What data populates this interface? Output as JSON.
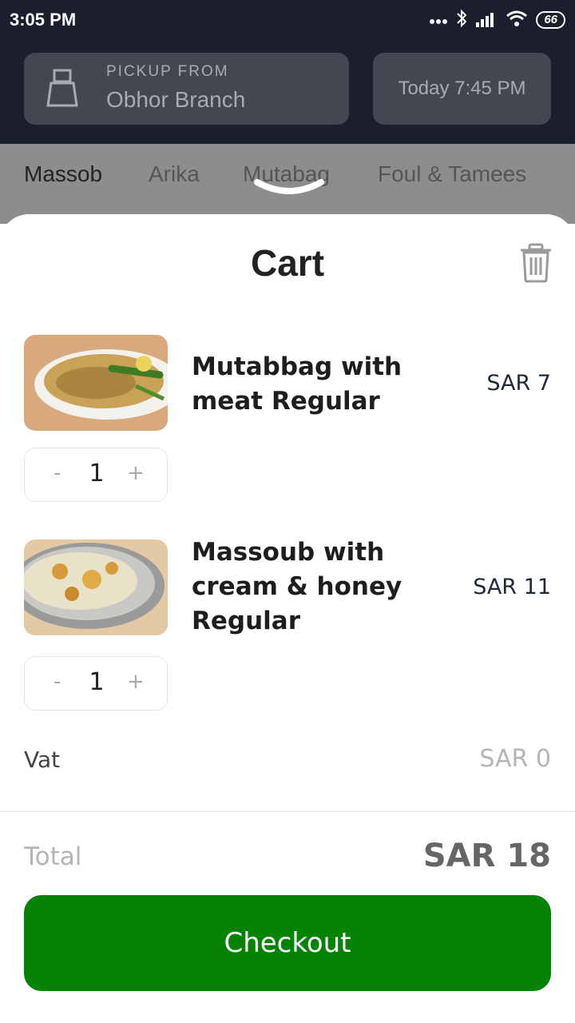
{
  "status_bar": {
    "time": "3:05 PM",
    "battery": "66"
  },
  "header": {
    "pickup_label": "PICKUP FROM",
    "pickup_branch": "Obhor Branch",
    "pickup_time": "Today 7:45 PM"
  },
  "categories": [
    {
      "label": "Massob",
      "active": true
    },
    {
      "label": "Arika",
      "active": false
    },
    {
      "label": "Mutabag",
      "active": false
    },
    {
      "label": "Foul & Tamees",
      "active": false
    }
  ],
  "cart": {
    "title": "Cart",
    "items": [
      {
        "name": "Mutabbag with meat Regular",
        "price": "SAR 7",
        "quantity": "1",
        "minus": "-",
        "plus": "+"
      },
      {
        "name": "Massoub with cream & honey Regular",
        "price": "SAR 11",
        "quantity": "1",
        "minus": "-",
        "plus": "+"
      }
    ],
    "vat_label": "Vat",
    "vat_value": "SAR 0",
    "total_label": "Total",
    "total_value": "SAR 18",
    "checkout_label": "Checkout"
  },
  "colors": {
    "header_bg": "#1b1e2c",
    "checkout_green": "#058304",
    "tab_bg": "#8d8d8d"
  },
  "icons": [
    "bluetooth-icon",
    "signal-icon",
    "wifi-icon",
    "battery-icon",
    "store-icon",
    "trash-icon"
  ]
}
